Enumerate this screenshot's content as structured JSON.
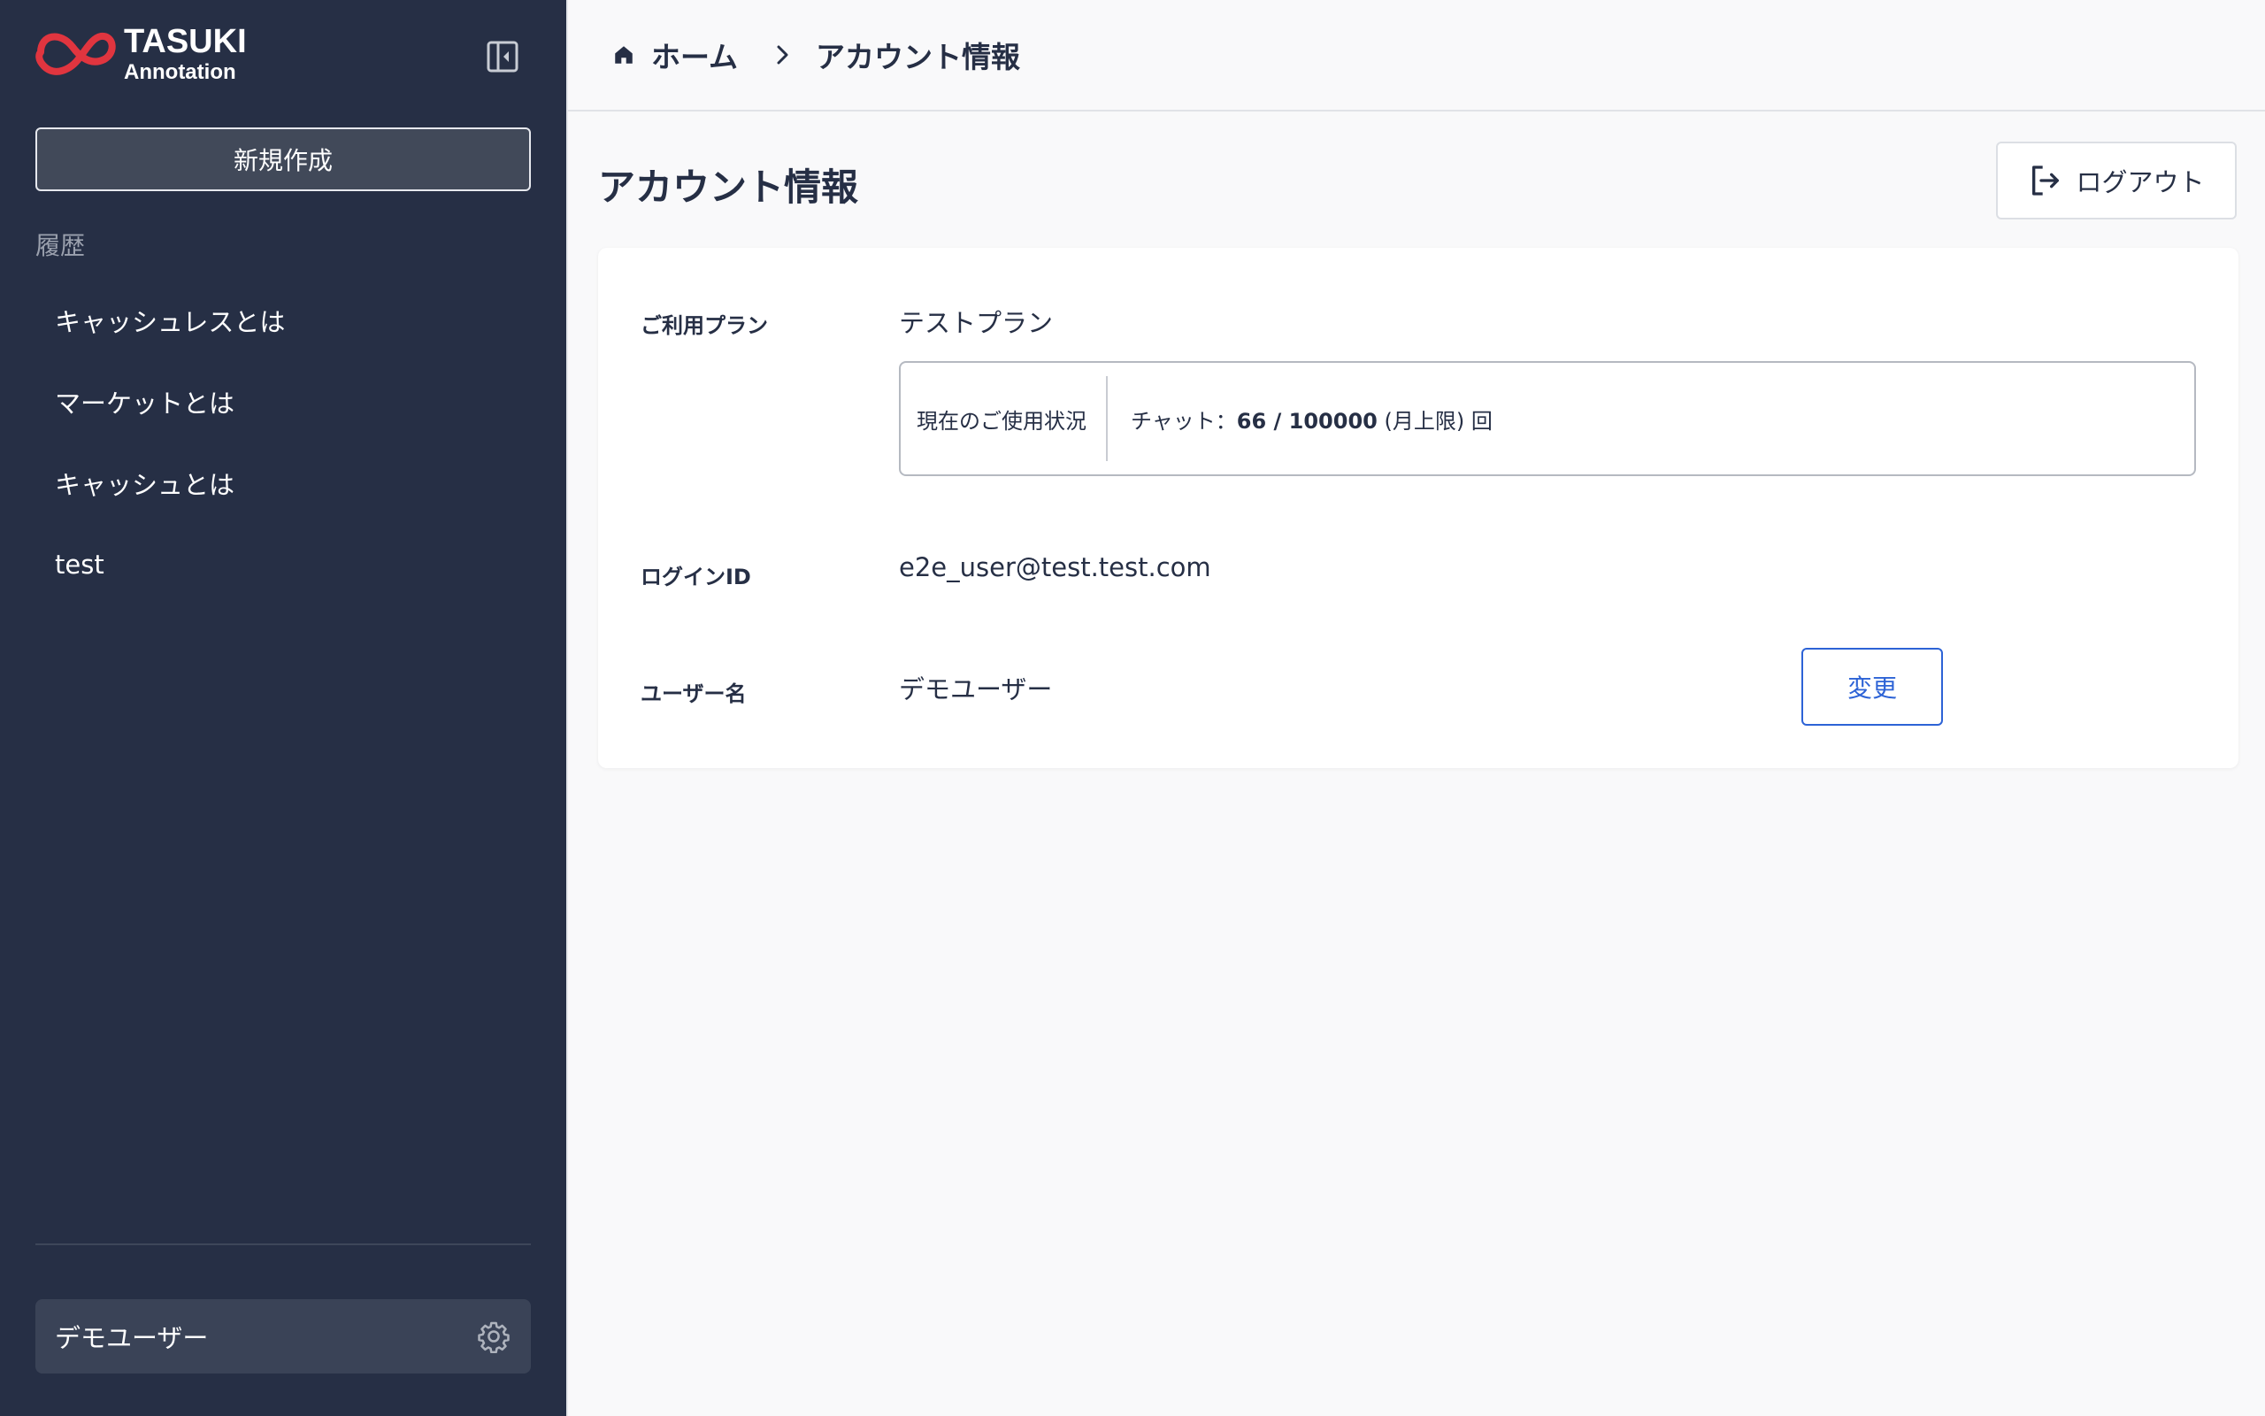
{
  "sidebar": {
    "logo": {
      "title": "TASUKI",
      "subtitle": "Annotation",
      "accent": "#e0353f"
    },
    "new_button": "新規作成",
    "history_label": "履歴",
    "history_items": [
      {
        "label": "キャッシュレスとは"
      },
      {
        "label": "マーケットとは"
      },
      {
        "label": "キャッシュとは"
      },
      {
        "label": "test"
      }
    ],
    "user_name": "デモユーザー"
  },
  "breadcrumb": {
    "home": "ホーム",
    "current": "アカウント情報"
  },
  "page": {
    "title": "アカウント情報",
    "logout_label": "ログアウト"
  },
  "account": {
    "plan_label": "ご利用プラン",
    "plan_value": "テストプラン",
    "usage": {
      "label": "現在のご使用状況",
      "prefix": "チャット：",
      "count": "66 / 100000",
      "suffix": " (月上限) 回"
    },
    "login_id_label": "ログインID",
    "login_id_value": "e2e_user@test.test.com",
    "username_label": "ユーザー名",
    "username_value": "デモユーザー",
    "change_button": "変更"
  },
  "colors": {
    "sidebar_bg": "#262f45",
    "accent_blue": "#2d63d6",
    "logo_red": "#e0353f"
  }
}
